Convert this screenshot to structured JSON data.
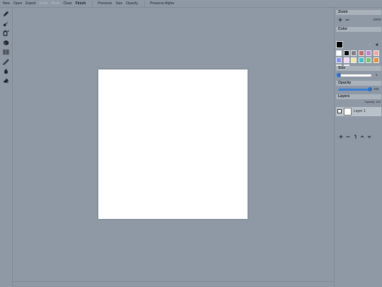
{
  "menu": {
    "new": "New",
    "open": "Open",
    "export": "Export",
    "undo": "Undo",
    "redo": "Redo",
    "clear": "Clear",
    "finish": "Finish",
    "pressure": "Pressure",
    "size": "Size",
    "opacity": "Opacity",
    "preserve_alpha": "Preserve Alpha"
  },
  "tools": [
    "pencil-icon",
    "brush-icon",
    "bucket-fill-icon",
    "blend-icon",
    "pattern-icon",
    "eyedropper-icon",
    "blur-drop-icon",
    "eraser-icon"
  ],
  "panel": {
    "zoom": {
      "title": "Zoom",
      "value": "100%"
    },
    "color": {
      "title": "Color",
      "current": "#000000",
      "swatches": [
        "#ffffff",
        "#000000",
        "#7f7f7f",
        "#c36a6a",
        "#c782c7",
        "#f4a3a3",
        "#8a90f0",
        "#f7d3f7",
        "#f2e6a0",
        "#3cc0c4",
        "#72c472",
        "#e88f3a",
        "#fbe9e1",
        "#fff1ec"
      ]
    },
    "size": {
      "title": "Size",
      "value": "1",
      "fraction": 0.02
    },
    "opacity": {
      "title": "Opacity",
      "value": "100",
      "fraction": 1.0
    },
    "layers": {
      "title": "Layers",
      "opacity_label": "Opacity: 100",
      "items": [
        {
          "name": "Layer 1"
        }
      ]
    }
  },
  "colors": {
    "accent": "#3b7fd1",
    "background": "#8e99a5",
    "canvas": "#ffffff"
  }
}
